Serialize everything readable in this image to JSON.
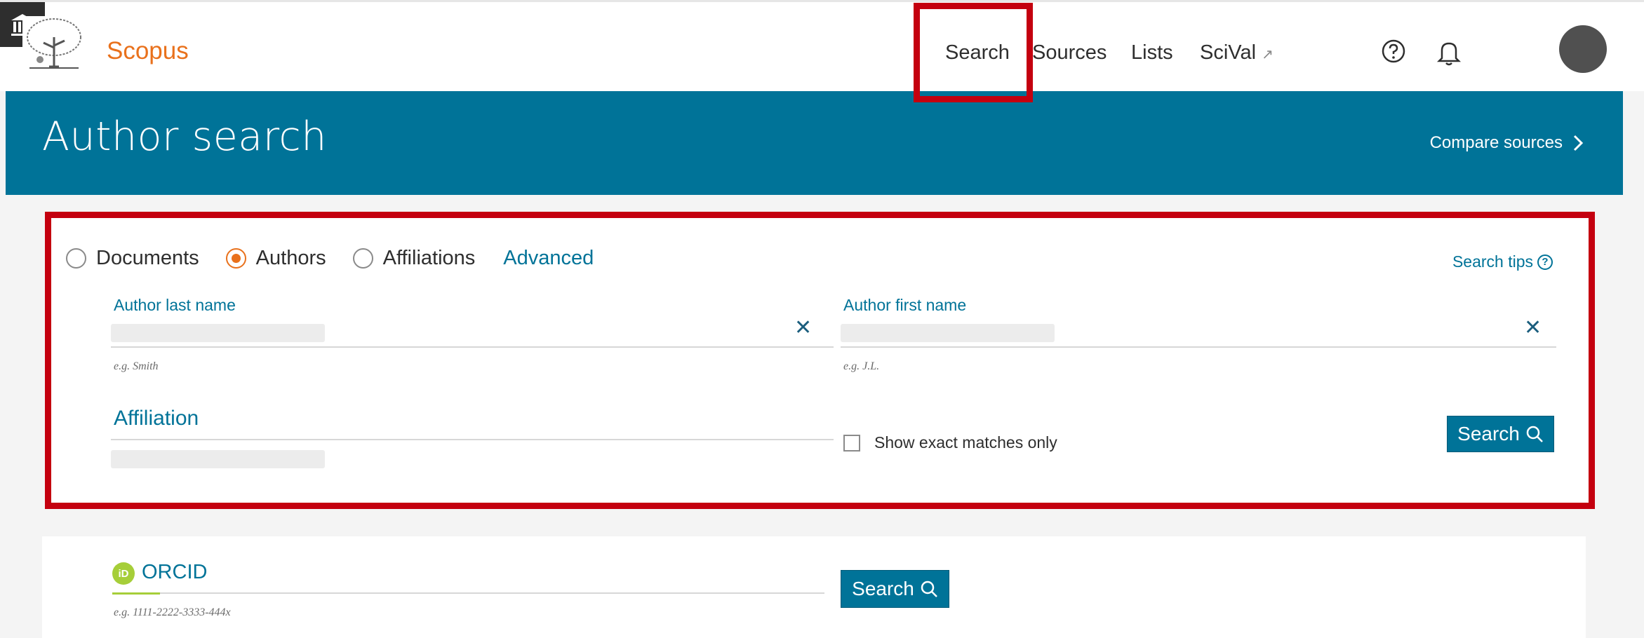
{
  "header": {
    "brand": "Scopus",
    "nav": [
      {
        "label": "Search"
      },
      {
        "label": "Sources"
      },
      {
        "label": "Lists"
      },
      {
        "label": "SciVal",
        "external_icon": "↗"
      }
    ],
    "icons": [
      "help-icon",
      "bell-icon",
      "institution-icon",
      "avatar"
    ]
  },
  "banner": {
    "title": "Author search",
    "compare_sources": "Compare sources"
  },
  "search_form": {
    "types": [
      {
        "label": "Documents",
        "selected": false
      },
      {
        "label": "Authors",
        "selected": true
      },
      {
        "label": "Affiliations",
        "selected": false
      }
    ],
    "advanced": "Advanced",
    "search_tips": "Search tips",
    "last_name": {
      "label": "Author last name",
      "value": "",
      "hint": "e.g. Smith"
    },
    "first_name": {
      "label": "Author first name",
      "value": "",
      "hint": "e.g. J.L."
    },
    "affiliation": {
      "label": "Affiliation",
      "value": ""
    },
    "exact_matches": {
      "label": "Show exact matches only",
      "checked": false
    },
    "search_button": "Search"
  },
  "orcid": {
    "label": "ORCID",
    "logo_text": "iD",
    "hint": "e.g. 1111-2222-3333-444x",
    "search_button": "Search"
  },
  "colors": {
    "brand": "#e9711c",
    "primary": "#007398",
    "highlight": "#c4000f",
    "orcid": "#a6ce39"
  }
}
